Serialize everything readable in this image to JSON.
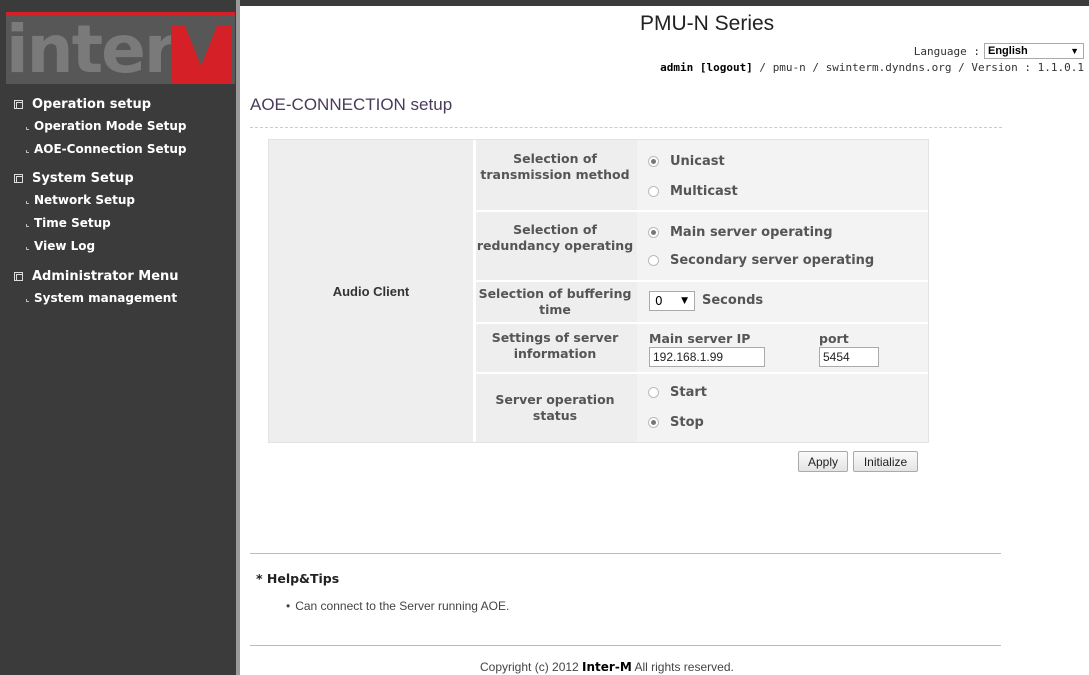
{
  "brand": {
    "logo_text": "InterM",
    "accent_color": "#d62028"
  },
  "header": {
    "title": "PMU-N Series",
    "language_label": "Language :",
    "language_value": "English",
    "user": "admin",
    "logout": "[logout]",
    "path_sep1": " / ",
    "model": "pmu-n",
    "path_sep2": " / ",
    "host": "swinterm.dyndns.org",
    "path_sep3": " / ",
    "version": "Version : 1.1.0.1"
  },
  "sidebar": {
    "groups": [
      {
        "label": "Operation setup",
        "items": [
          {
            "label": "Operation Mode Setup"
          },
          {
            "label": "AOE-Connection Setup"
          }
        ]
      },
      {
        "label": "System Setup",
        "items": [
          {
            "label": "Network Setup"
          },
          {
            "label": "Time Setup"
          },
          {
            "label": "View Log"
          }
        ]
      },
      {
        "label": "Administrator Menu",
        "items": [
          {
            "label": "System management"
          }
        ]
      }
    ]
  },
  "page": {
    "title": "AOE-CONNECTION setup",
    "section_label": "Audio Client",
    "rows": {
      "transmission": {
        "label": "Selection of transmission method",
        "options": [
          {
            "label": "Unicast",
            "selected": true
          },
          {
            "label": "Multicast",
            "selected": false
          }
        ]
      },
      "redundancy": {
        "label": "Selection of redundancy operating",
        "options": [
          {
            "label": "Main server operating",
            "selected": true
          },
          {
            "label": "Secondary server operating",
            "selected": false
          }
        ]
      },
      "buffering": {
        "label": "Selection of buffering time",
        "value": "0",
        "unit": "Seconds"
      },
      "server": {
        "label": "Settings of server information",
        "ip_label": "Main server IP",
        "ip_value": "192.168.1.99",
        "port_label": "port",
        "port_value": "5454"
      },
      "status": {
        "label": "Server operation status",
        "options": [
          {
            "label": "Start",
            "selected": false
          },
          {
            "label": "Stop",
            "selected": true
          }
        ]
      }
    },
    "buttons": {
      "apply": "Apply",
      "initialize": "Initialize"
    }
  },
  "help": {
    "title": "* Help&Tips",
    "items": [
      "Can connect to the Server running AOE."
    ]
  },
  "footer": {
    "prefix": "Copyright (c) 2012 ",
    "brand": "Inter-M",
    "suffix": " All rights reserved."
  }
}
